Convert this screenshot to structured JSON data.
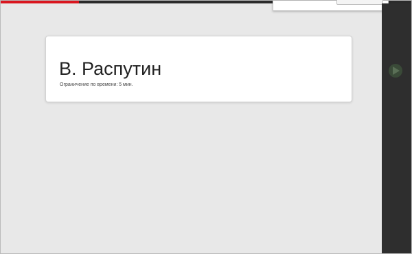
{
  "progress": {
    "fraction": 0.19,
    "color": "#d9161f"
  },
  "card": {
    "title": "В. Распутин",
    "subtitle": "Ограничение по времени: 5 мин."
  },
  "side_panel": {
    "play_icon": "play-icon"
  },
  "popup": {
    "button_label": ""
  }
}
